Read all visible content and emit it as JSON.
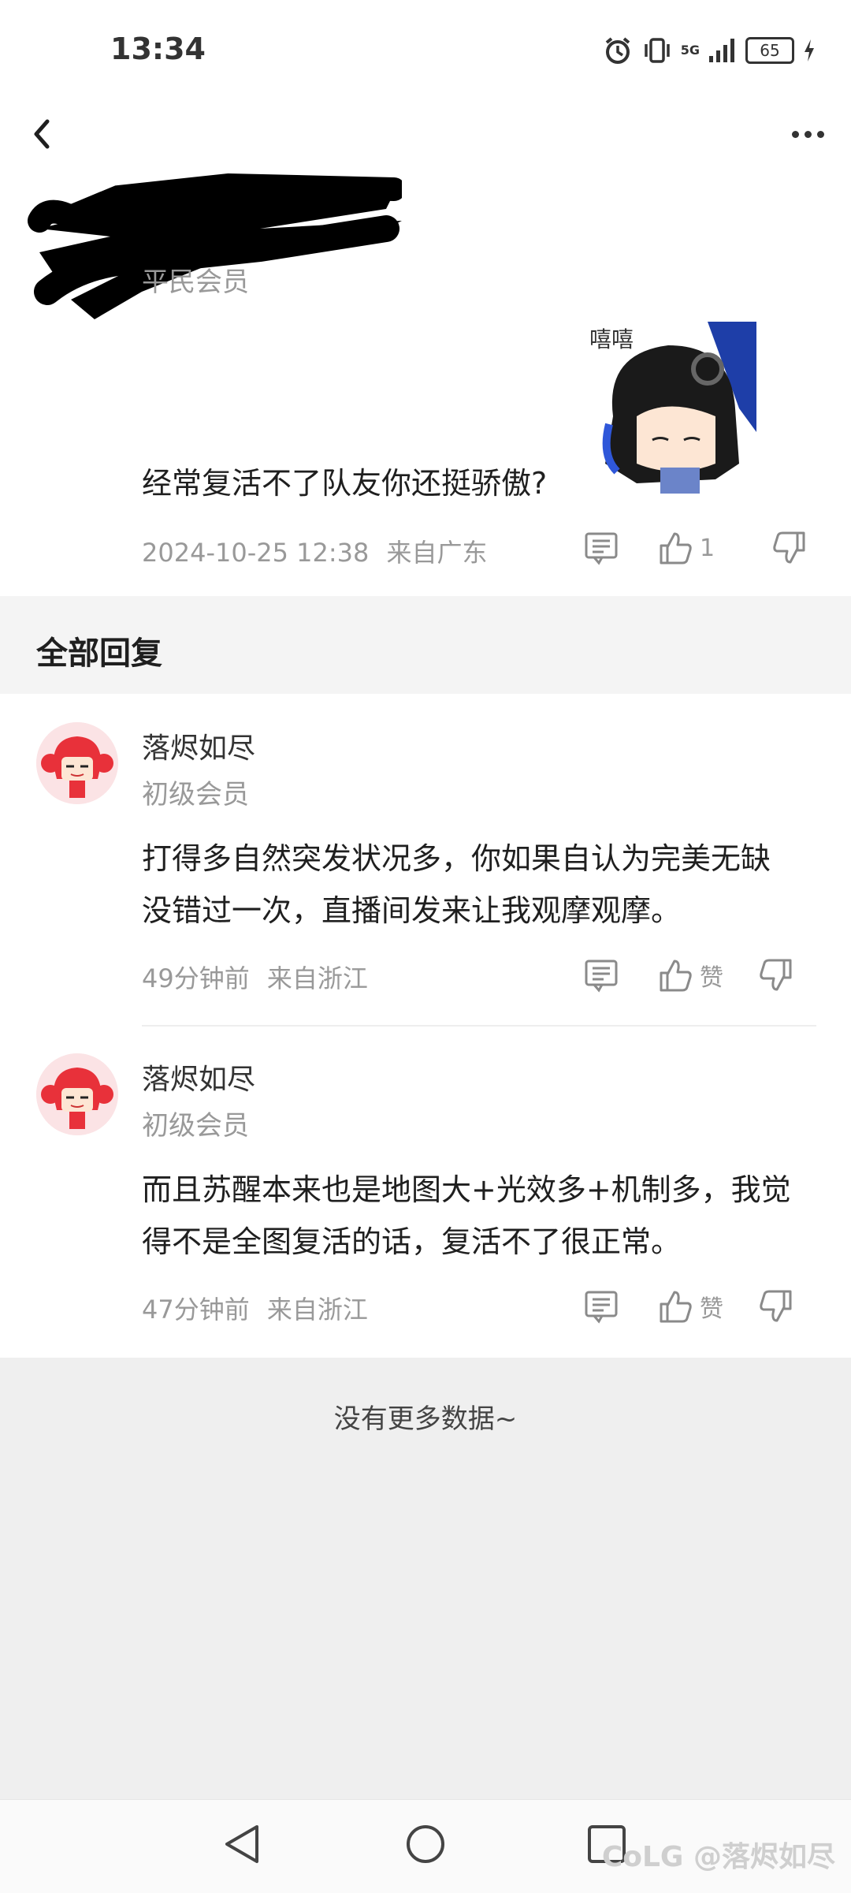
{
  "status_bar": {
    "time": "13:34",
    "network": "5G",
    "battery": "65"
  },
  "post": {
    "author_badge": "平民会员",
    "text": "经常复活不了队友你还挺骄傲?",
    "sticker_caption": "嘻嘻",
    "timestamp": "2024-10-25 12:38",
    "location": "来自广东",
    "like_count": "1"
  },
  "section": {
    "title": "全部回复"
  },
  "replies": [
    {
      "name": "落烬如尽",
      "badge": "初级会员",
      "line1": "打得多自然突发状况多，你如果自认为完美无缺",
      "line2": "没错过一次，直播间发来让我观摩观摩。",
      "time": "49分钟前",
      "location": "来自浙江",
      "like_label": "赞"
    },
    {
      "name": "落烬如尽",
      "badge": "初级会员",
      "line1": "而且苏醒本来也是地图大+光效多+机制多，我觉",
      "line2": "得不是全图复活的话，复活不了很正常。",
      "time": "47分钟前",
      "location": "来自浙江",
      "like_label": "赞"
    }
  ],
  "footer": {
    "no_more": "没有更多数据~",
    "watermark": "CoLG @落烬如尽"
  }
}
